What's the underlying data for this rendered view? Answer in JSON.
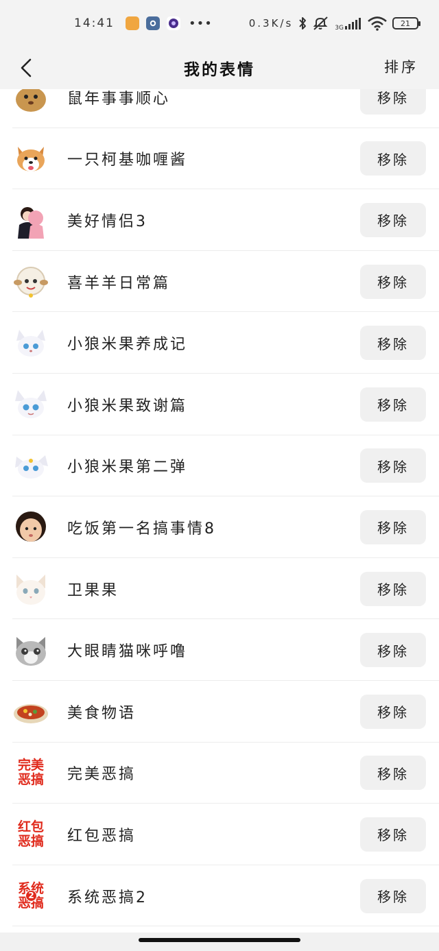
{
  "status_bar": {
    "time": "14:41",
    "network_speed": "0.3K/s",
    "network_type": "3G",
    "battery": "21",
    "more": "•••",
    "icons": [
      "app-orange-icon",
      "settings-blue-icon",
      "camera-purple-icon",
      "bluetooth-icon",
      "mute-icon",
      "signal-icon",
      "wifi-icon",
      "battery-icon"
    ]
  },
  "header": {
    "title": "我的表情",
    "sort_label": "排序",
    "back_icon": "chevron-left-icon"
  },
  "colors": {
    "bar_bg": "#f3f3f3",
    "button_bg": "#f0f0f0",
    "logo_red": "#e02a1c",
    "divider": "#ececec"
  },
  "stickers": [
    {
      "name": "鼠年事事顺心",
      "remove_label": "移除",
      "thumb": "mouse"
    },
    {
      "name": "一只柯基咖喱酱",
      "remove_label": "移除",
      "thumb": "corgi"
    },
    {
      "name": "美好情侣3",
      "remove_label": "移除",
      "thumb": "couple"
    },
    {
      "name": "喜羊羊日常篇",
      "remove_label": "移除",
      "thumb": "sheep"
    },
    {
      "name": "小狼米果养成记",
      "remove_label": "移除",
      "thumb": "wolf"
    },
    {
      "name": "小狼米果致谢篇",
      "remove_label": "移除",
      "thumb": "wolf"
    },
    {
      "name": "小狼米果第二弹",
      "remove_label": "移除",
      "thumb": "wolf"
    },
    {
      "name": "吃饭第一名搞事情8",
      "remove_label": "移除",
      "thumb": "kid"
    },
    {
      "name": "卫果果",
      "remove_label": "移除",
      "thumb": "white-cat"
    },
    {
      "name": "大眼睛猫咪呼噜",
      "remove_label": "移除",
      "thumb": "grey-cat"
    },
    {
      "name": "美食物语",
      "remove_label": "移除",
      "thumb": "food"
    },
    {
      "name": "完美恶搞",
      "remove_label": "移除",
      "thumb": "text",
      "logo": [
        "完美",
        "恶搞"
      ]
    },
    {
      "name": "红包恶搞",
      "remove_label": "移除",
      "thumb": "text",
      "logo": [
        "红包",
        "恶搞"
      ]
    },
    {
      "name": "系统恶搞2",
      "remove_label": "移除",
      "thumb": "text",
      "logo": [
        "系统",
        "恶搞"
      ],
      "badge": "2"
    }
  ]
}
